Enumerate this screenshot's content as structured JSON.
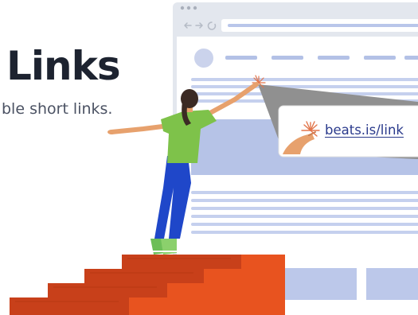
{
  "hero": {
    "headline": "Links",
    "subline": "ble short links."
  },
  "popup": {
    "link_text": "beats.is/link"
  },
  "colors": {
    "headline": "#1d2330",
    "browser_frame": "#e3e7ee",
    "skeleton_blue": "#aebde3",
    "callout_gray": "#909090",
    "stairs_orange": "#e8531f",
    "stairs_dark": "#b8320e",
    "shirt_green": "#7ec24a",
    "pants_blue": "#1f47c9",
    "link_blue": "#2a3a8c",
    "spark_orange": "#e2754a"
  },
  "icons": [
    "back-arrow-icon",
    "forward-arrow-icon",
    "reload-icon",
    "spark-icon"
  ]
}
